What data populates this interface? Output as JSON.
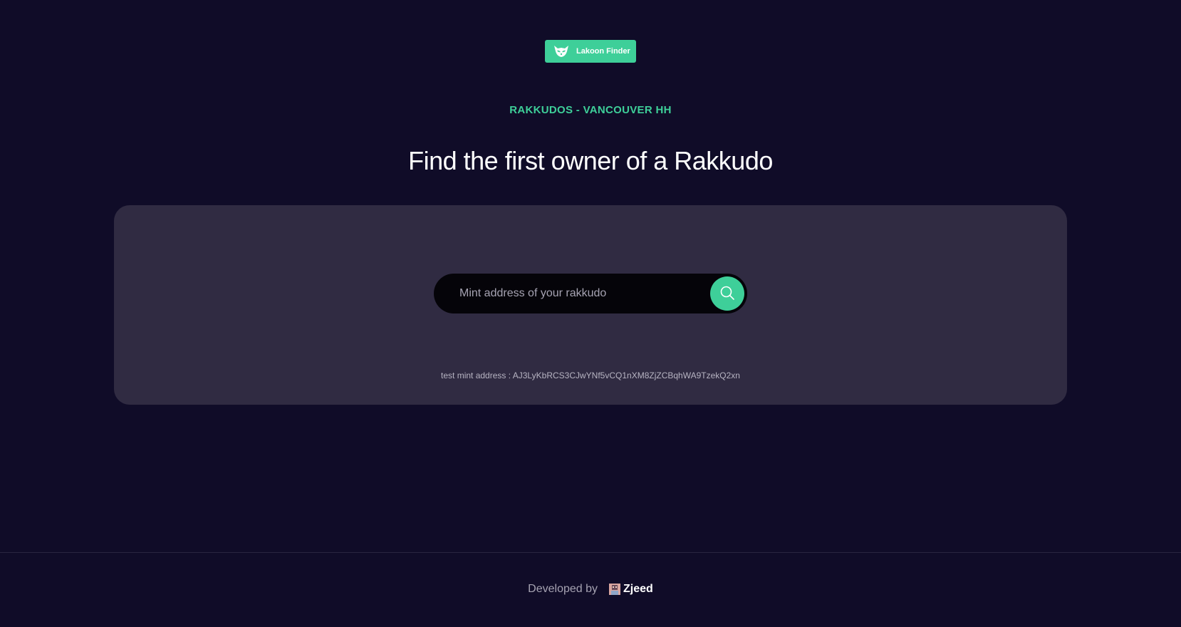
{
  "header": {
    "logo_label": "Lakoon Finder",
    "logo_icon": "raccoon-icon",
    "subtitle": "RAKKUDOS - VANCOUVER HH",
    "headline": "Find the first owner of a Rakkudo"
  },
  "search": {
    "placeholder": "Mint address of your rakkudo",
    "value": "",
    "button_icon": "search-icon"
  },
  "test_mint": {
    "text": "test mint address : AJ3LyKbRCS3CJwYNf5vCQ1nXM8ZjZCBqhWA9TzekQ2xn"
  },
  "footer": {
    "label": "Developed by",
    "developer_name": "Zjeed",
    "developer_icon": "avatar-icon"
  },
  "colors": {
    "background": "#100c28",
    "accent": "#3ecf99",
    "card": "#302b42",
    "search_bar": "#050409"
  }
}
